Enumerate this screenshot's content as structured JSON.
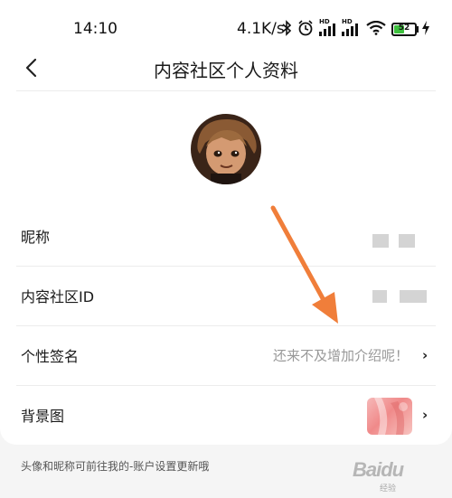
{
  "status_bar": {
    "time": "14:10",
    "network_speed": "4.1K/s",
    "battery_level": "52",
    "battery_fraction": 0.52,
    "icons": [
      "bluetooth-icon",
      "alarm-icon",
      "signal-hd-icon",
      "signal-hd-icon",
      "wifi-icon",
      "battery-icon",
      "charging-icon"
    ]
  },
  "header": {
    "back_icon": "chevron-left-icon",
    "title": "内容社区个人资料"
  },
  "profile_rows": [
    {
      "label": "昵称",
      "value": ""
    },
    {
      "label": "内容社区ID",
      "value": ""
    },
    {
      "label": "个性签名",
      "value": "还来不及增加介绍呢！",
      "chevron": "›"
    },
    {
      "label": "背景图",
      "value": "",
      "chevron": "›"
    }
  ],
  "footer_tip": "头像和昵称可前往我的-账户设置更新哦",
  "watermark": {
    "text": "Baidu",
    "sub": "经验"
  },
  "colors": {
    "annotation_arrow": "#f07e3a",
    "card_bg": "#ffffff",
    "page_bg": "#f5f5f5",
    "battery_green": "#3ec03e"
  }
}
